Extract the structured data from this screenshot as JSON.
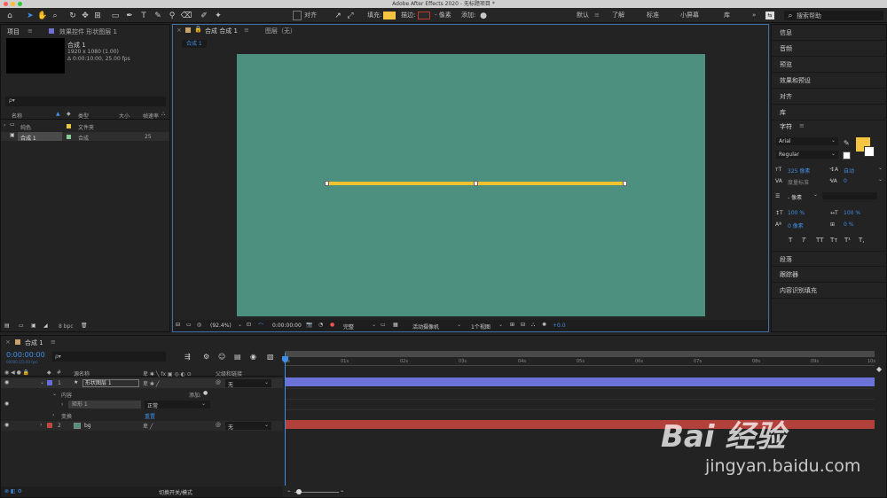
{
  "app": {
    "title": "Adobe After Effects 2020 - 无标题项目 *"
  },
  "toolbar": {
    "align_label": "对齐",
    "fill_label": "填充:",
    "stroke_label": "描边:",
    "stroke_width": "- 像素",
    "add_label": "添加:",
    "fill_color": "#f5c542",
    "workspaces": [
      "默认",
      "了解",
      "标准",
      "小屏幕",
      "库"
    ],
    "active_workspace": "默认",
    "search_placeholder": "搜索帮助"
  },
  "project": {
    "tab_label": "项目",
    "effects_tab": "效果控件 形状图层 1",
    "comp_name": "合成 1",
    "comp_size": "1920 x 1080 (1.00)",
    "comp_duration": "Δ 0:00:10:00, 25.00 fps",
    "search_placeholder": "ρ▾",
    "columns": [
      "名称",
      "类型",
      "大小",
      "帧速率"
    ],
    "items": [
      {
        "name": "纯色",
        "type": "文件夹",
        "fps": ""
      },
      {
        "name": "合成 1",
        "type": "合成",
        "fps": "25"
      }
    ],
    "bpc": "8 bpc"
  },
  "composition": {
    "tab_label": "合成 合成 1",
    "layer_label": "图层（无）",
    "breadcrumb": "合成 1",
    "bg_color": "#4e9080",
    "line_color": "#f2c230",
    "zoom": "(92.4%)",
    "timecode": "0:00:00:00",
    "resolution": "完整",
    "camera": "活动摄像机",
    "views": "1个视图",
    "exposure": "+0.0"
  },
  "right_panels": {
    "items_top": [
      "信息",
      "音频",
      "预览",
      "效果和预设",
      "对齐",
      "库"
    ],
    "character": {
      "title": "字符",
      "font": "Arial",
      "style": "Regular",
      "font_size": "325 像素",
      "leading": "自动",
      "kerning": "度量标准",
      "tracking": "0",
      "stroke_width": "- 像素",
      "vscale": "100 %",
      "hscale": "100 %",
      "baseline": "0 像素",
      "tsume": "0 %",
      "styles": [
        "T",
        "T",
        "TT",
        "Tт",
        "T¹",
        "T,"
      ],
      "fill_color": "#f5c542"
    },
    "items_bottom": [
      "段落",
      "跟踪器",
      "内容识别填充"
    ]
  },
  "timeline": {
    "tab_label": "合成 1",
    "timecode": "0:00:00:00",
    "timecode_sub": "00000 (25.00 fps)",
    "search_placeholder": "ρ▾",
    "col_source": "源名称",
    "col_parent": "父级和链接",
    "col_hash": "#",
    "ruler": [
      "0s",
      "01s",
      "02s",
      "03s",
      "04s",
      "05s",
      "06s",
      "07s",
      "08s",
      "09s",
      "10s"
    ],
    "layers": [
      {
        "num": "1",
        "name": "形状图层 1",
        "parent": "无",
        "color": "#6b6bd6"
      },
      {
        "num": "2",
        "name": "bg",
        "parent": "无",
        "color": "#c0483f"
      }
    ],
    "contents_label": "内容",
    "add_label": "添加:",
    "rect_label": "矩形 1",
    "blend_mode": "正常",
    "transform_label": "变换",
    "reset_label": "重置",
    "toggle_label": "切换开关/模式",
    "bar1_color": "#6b72d8",
    "bar2_color": "#b3413b"
  },
  "watermark": {
    "brand": "Bai 经验",
    "url": "jingyan.baidu.com"
  }
}
